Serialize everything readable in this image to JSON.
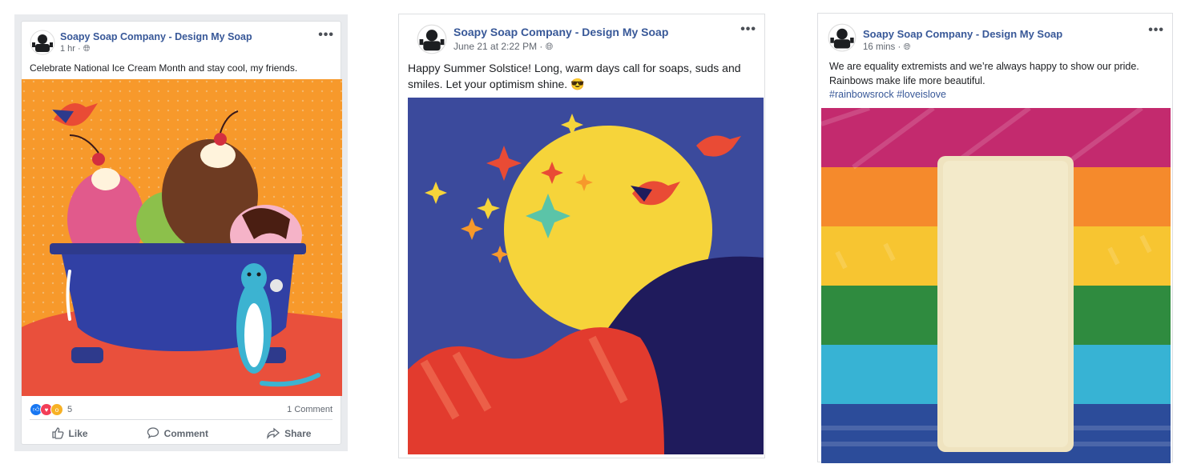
{
  "posts": [
    {
      "page_name": "Soapy Soap Company - Design My Soap",
      "time": "1 hr",
      "text": "Celebrate National Ice Cream Month and stay cool, my friends.",
      "reaction_count": "5",
      "comment_count": "1 Comment",
      "actions": {
        "like": "Like",
        "comment": "Comment",
        "share": "Share"
      }
    },
    {
      "page_name": "Soapy Soap Company - Design My Soap",
      "time": "June 21 at 2:22 PM",
      "text": "Happy Summer Solstice! Long, warm days call for soaps, suds and smiles. Let your optimism shine. 😎"
    },
    {
      "page_name": "Soapy Soap Company - Design My Soap",
      "time": "16 mins",
      "text": "We are equality extremists and we’re always happy to show our pride. Rainbows make life more beautiful.",
      "hashtags": "#rainbowsrock #loveislove"
    }
  ],
  "colors": {
    "link": "#385898",
    "orange_bg": "#f7992b",
    "navy_bg": "#3b4a9c",
    "moon": "#f6d43a",
    "bird": "#e94b35"
  },
  "icons": [
    "avatar-icon",
    "globe-icon",
    "more-icon",
    "like-icon",
    "comment-icon",
    "share-icon"
  ]
}
